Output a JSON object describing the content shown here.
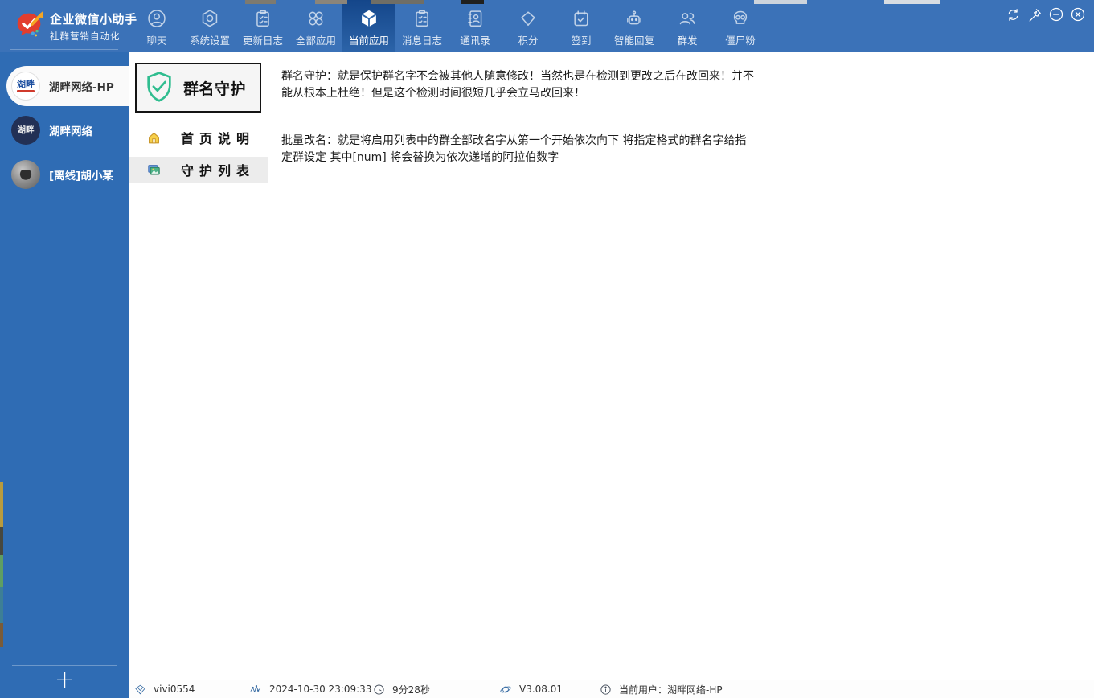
{
  "app": {
    "title": "企业微信小助手",
    "subtitle": "社群营销自动化"
  },
  "nav": {
    "tabs": [
      {
        "label": "聊天",
        "icon": "chat-icon",
        "active": false
      },
      {
        "label": "系统设置",
        "icon": "settings-hexagon-icon",
        "active": false
      },
      {
        "label": "更新日志",
        "icon": "changelog-icon",
        "active": false
      },
      {
        "label": "全部应用",
        "icon": "all-apps-icon",
        "active": false
      },
      {
        "label": "当前应用",
        "icon": "current-app-cube-icon",
        "active": true
      },
      {
        "label": "消息日志",
        "icon": "message-log-icon",
        "active": false
      },
      {
        "label": "通讯录",
        "icon": "contacts-icon",
        "active": false
      },
      {
        "label": "积分",
        "icon": "points-diamond-icon",
        "active": false
      },
      {
        "label": "签到",
        "icon": "signin-calendar-icon",
        "active": false
      },
      {
        "label": "智能回复",
        "icon": "robot-icon",
        "active": false
      },
      {
        "label": "群发",
        "icon": "group-send-icon",
        "active": false
      },
      {
        "label": "僵尸粉",
        "icon": "zombie-skull-icon",
        "active": false
      }
    ]
  },
  "window_controls": [
    {
      "icon": "refresh-icon"
    },
    {
      "icon": "pin-icon"
    },
    {
      "icon": "minimize-icon"
    },
    {
      "icon": "close-icon"
    }
  ],
  "sidebar": {
    "accounts": [
      {
        "name": "湖畔网络-HP",
        "avatar_text": "湖畔",
        "selected": true,
        "avatar_style": "white-logo"
      },
      {
        "name": "湖畔网络",
        "avatar_text": "湖畔",
        "selected": false,
        "avatar_style": "dark-logo"
      },
      {
        "name": "[离线]胡小某",
        "avatar_text": "",
        "selected": false,
        "avatar_style": "photo"
      }
    ],
    "add_label": "+"
  },
  "panel": {
    "header": "群名守护",
    "menu": [
      {
        "label": "首页说明",
        "icon": "home-icon",
        "highlighted": false
      },
      {
        "label": "守护列表",
        "icon": "gallery-icon",
        "highlighted": true
      }
    ]
  },
  "content": {
    "paragraphs": [
      "群名守护：就是保护群名字不会被其他人随意修改！当然也是在检测到更改之后在改回来！并不能从根本上杜绝！但是这个检测时间很短几乎会立马改回来！",
      "批量改名：就是将启用列表中的群全部改名字从第一个开始依次向下 将指定格式的群名字给指定群设定 其中[num] 将会替换为依次递增的阿拉伯数字"
    ]
  },
  "statusbar": {
    "items": [
      {
        "icon": "license-badge-icon",
        "text": "vivi0554"
      },
      {
        "icon": "activity-pulse-icon",
        "text": "2024-10-30 23:09:33"
      },
      {
        "icon": "clock-icon",
        "text": "9分28秒"
      },
      {
        "icon": "version-orbit-icon",
        "text": "V3.08.01"
      },
      {
        "icon": "user-info-icon",
        "text": "当前用户：湖畔网络-HP"
      }
    ]
  },
  "colors": {
    "topbar_blue": "#3b72b8",
    "sidebar_blue": "#2f6cb4",
    "active_tab_blue": "#14468a",
    "accent_green": "#2fbd8f",
    "divider_olive": "#8a8a5c",
    "logo_red": "#e23d2e",
    "logo_orange": "#f5a623",
    "home_icon_yellow": "#f7d04a"
  }
}
